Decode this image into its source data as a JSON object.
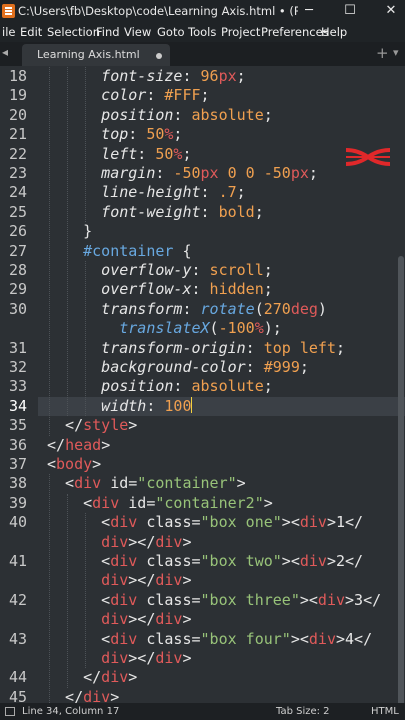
{
  "window": {
    "title": "C:\\Users\\fb\\Desktop\\code\\Learning Axis.html • (Project) - Su...",
    "minimize_glyph": "─",
    "maximize_glyph": "☐",
    "close_glyph": "✕"
  },
  "menu": [
    "ile",
    "Edit",
    "Selection",
    "Find",
    "View",
    "Goto",
    "Tools",
    "Project",
    "Preferences",
    "Help"
  ],
  "tab": {
    "label": "Learning Axis.html",
    "left_arrow": "◂",
    "new_tab": "+",
    "chevron": "▾"
  },
  "editor": {
    "current_line": "34",
    "lines": [
      {
        "n": "18",
        "indent": 3,
        "tokens": [
          [
            "p",
            "font-size"
          ],
          [
            "w",
            ": "
          ],
          [
            "n",
            "96"
          ],
          [
            "u",
            "px"
          ],
          [
            "w",
            ";"
          ]
        ]
      },
      {
        "n": "19",
        "indent": 3,
        "tokens": [
          [
            "p",
            "color"
          ],
          [
            "w",
            ": "
          ],
          [
            "n",
            "#FFF"
          ],
          [
            "w",
            ";"
          ]
        ]
      },
      {
        "n": "20",
        "indent": 3,
        "tokens": [
          [
            "p",
            "position"
          ],
          [
            "w",
            ": "
          ],
          [
            "v",
            "absolute"
          ],
          [
            "w",
            ";"
          ]
        ]
      },
      {
        "n": "21",
        "indent": 3,
        "tokens": [
          [
            "p",
            "top"
          ],
          [
            "w",
            ": "
          ],
          [
            "n",
            "50"
          ],
          [
            "u",
            "%"
          ],
          [
            "w",
            ";"
          ]
        ]
      },
      {
        "n": "22",
        "indent": 3,
        "tokens": [
          [
            "p",
            "left"
          ],
          [
            "w",
            ": "
          ],
          [
            "n",
            "50"
          ],
          [
            "u",
            "%"
          ],
          [
            "w",
            ";"
          ]
        ]
      },
      {
        "n": "23",
        "indent": 3,
        "tokens": [
          [
            "p",
            "margin"
          ],
          [
            "w",
            ": "
          ],
          [
            "n",
            "-50"
          ],
          [
            "u",
            "px"
          ],
          [
            "w",
            " "
          ],
          [
            "n",
            "0"
          ],
          [
            "w",
            " "
          ],
          [
            "n",
            "0"
          ],
          [
            "w",
            " "
          ],
          [
            "n",
            "-50"
          ],
          [
            "u",
            "px"
          ],
          [
            "w",
            ";"
          ]
        ]
      },
      {
        "n": "24",
        "indent": 3,
        "tokens": [
          [
            "p",
            "line-height"
          ],
          [
            "w",
            ": "
          ],
          [
            "n",
            ".7"
          ],
          [
            "w",
            ";"
          ]
        ]
      },
      {
        "n": "25",
        "indent": 3,
        "tokens": [
          [
            "p",
            "font-weight"
          ],
          [
            "w",
            ": "
          ],
          [
            "v",
            "bold"
          ],
          [
            "w",
            ";"
          ]
        ]
      },
      {
        "n": "26",
        "indent": 2,
        "tokens": [
          [
            "w",
            "}"
          ]
        ]
      },
      {
        "n": "27",
        "indent": 2,
        "tokens": [
          [
            "sel",
            "#container"
          ],
          [
            "w",
            " {"
          ]
        ]
      },
      {
        "n": "28",
        "indent": 3,
        "tokens": [
          [
            "p",
            "overflow-y"
          ],
          [
            "w",
            ": "
          ],
          [
            "v",
            "scroll"
          ],
          [
            "w",
            ";"
          ]
        ]
      },
      {
        "n": "29",
        "indent": 3,
        "tokens": [
          [
            "p",
            "overflow-x"
          ],
          [
            "w",
            ": "
          ],
          [
            "v",
            "hidden"
          ],
          [
            "w",
            ";"
          ]
        ]
      },
      {
        "n": "30",
        "indent": 3,
        "tokens": [
          [
            "p",
            "transform"
          ],
          [
            "w",
            ": "
          ],
          [
            "fn",
            "rotate"
          ],
          [
            "w",
            "("
          ],
          [
            "n",
            "270"
          ],
          [
            "u",
            "deg"
          ],
          [
            "w",
            ")"
          ]
        ]
      },
      {
        "n": "",
        "indent": 4,
        "tokens": [
          [
            "fn",
            "translateX"
          ],
          [
            "w",
            "("
          ],
          [
            "n",
            "-100"
          ],
          [
            "u",
            "%"
          ],
          [
            "w",
            ");"
          ]
        ]
      },
      {
        "n": "31",
        "indent": 3,
        "tokens": [
          [
            "p",
            "transform-origin"
          ],
          [
            "w",
            ": "
          ],
          [
            "v",
            "top left"
          ],
          [
            "w",
            ";"
          ]
        ]
      },
      {
        "n": "32",
        "indent": 3,
        "tokens": [
          [
            "p",
            "background-color"
          ],
          [
            "w",
            ": "
          ],
          [
            "n",
            "#999"
          ],
          [
            "w",
            ";"
          ]
        ]
      },
      {
        "n": "33",
        "indent": 3,
        "tokens": [
          [
            "p",
            "position"
          ],
          [
            "w",
            ": "
          ],
          [
            "v",
            "absolute"
          ],
          [
            "w",
            ";"
          ]
        ]
      },
      {
        "n": "34",
        "indent": 3,
        "caret": true,
        "tokens": [
          [
            "p",
            "width"
          ],
          [
            "w",
            ": "
          ],
          [
            "n",
            "100"
          ]
        ]
      },
      {
        "n": "35",
        "indent": 1,
        "tokens": [
          [
            "w",
            "</"
          ],
          [
            "tag",
            "style"
          ],
          [
            "w",
            ">"
          ]
        ]
      },
      {
        "n": "36",
        "indent": 0,
        "tokens": [
          [
            "w",
            "</"
          ],
          [
            "tag",
            "head"
          ],
          [
            "w",
            ">"
          ]
        ]
      },
      {
        "n": "37",
        "indent": 0,
        "tokens": [
          [
            "w",
            "<"
          ],
          [
            "tag",
            "body"
          ],
          [
            "w",
            ">"
          ]
        ]
      },
      {
        "n": "38",
        "indent": 1,
        "tokens": [
          [
            "w",
            "<"
          ],
          [
            "tag",
            "div"
          ],
          [
            "w",
            " "
          ],
          [
            "at",
            "id"
          ],
          [
            "w",
            "="
          ],
          [
            "str",
            "\"container\""
          ],
          [
            "w",
            ">"
          ]
        ]
      },
      {
        "n": "39",
        "indent": 2,
        "tokens": [
          [
            "w",
            "<"
          ],
          [
            "tag",
            "div"
          ],
          [
            "w",
            " "
          ],
          [
            "at",
            "id"
          ],
          [
            "w",
            "="
          ],
          [
            "str",
            "\"container2\""
          ],
          [
            "w",
            ">"
          ]
        ]
      },
      {
        "n": "40",
        "indent": 3,
        "tokens": [
          [
            "w",
            "<"
          ],
          [
            "tag",
            "div"
          ],
          [
            "w",
            " "
          ],
          [
            "at",
            "class"
          ],
          [
            "w",
            "="
          ],
          [
            "str",
            "\"box one\""
          ],
          [
            "w",
            "><"
          ],
          [
            "tag",
            "div"
          ],
          [
            "w",
            ">1</"
          ]
        ]
      },
      {
        "n": "",
        "indent": 3,
        "tokens": [
          [
            "tag",
            "div"
          ],
          [
            "w",
            "></"
          ],
          [
            "tag",
            "div"
          ],
          [
            "w",
            ">"
          ]
        ]
      },
      {
        "n": "41",
        "indent": 3,
        "tokens": [
          [
            "w",
            "<"
          ],
          [
            "tag",
            "div"
          ],
          [
            "w",
            " "
          ],
          [
            "at",
            "class"
          ],
          [
            "w",
            "="
          ],
          [
            "str",
            "\"box two\""
          ],
          [
            "w",
            "><"
          ],
          [
            "tag",
            "div"
          ],
          [
            "w",
            ">2</"
          ]
        ]
      },
      {
        "n": "",
        "indent": 3,
        "tokens": [
          [
            "tag",
            "div"
          ],
          [
            "w",
            "></"
          ],
          [
            "tag",
            "div"
          ],
          [
            "w",
            ">"
          ]
        ]
      },
      {
        "n": "42",
        "indent": 3,
        "tokens": [
          [
            "w",
            "<"
          ],
          [
            "tag",
            "div"
          ],
          [
            "w",
            " "
          ],
          [
            "at",
            "class"
          ],
          [
            "w",
            "="
          ],
          [
            "str",
            "\"box three\""
          ],
          [
            "w",
            "><"
          ],
          [
            "tag",
            "div"
          ],
          [
            "w",
            ">3</"
          ]
        ]
      },
      {
        "n": "",
        "indent": 3,
        "tokens": [
          [
            "tag",
            "div"
          ],
          [
            "w",
            "></"
          ],
          [
            "tag",
            "div"
          ],
          [
            "w",
            ">"
          ]
        ]
      },
      {
        "n": "43",
        "indent": 3,
        "tokens": [
          [
            "w",
            "<"
          ],
          [
            "tag",
            "div"
          ],
          [
            "w",
            " "
          ],
          [
            "at",
            "class"
          ],
          [
            "w",
            "="
          ],
          [
            "str",
            "\"box four\""
          ],
          [
            "w",
            "><"
          ],
          [
            "tag",
            "div"
          ],
          [
            "w",
            ">4</"
          ]
        ]
      },
      {
        "n": "",
        "indent": 3,
        "tokens": [
          [
            "tag",
            "div"
          ],
          [
            "w",
            "></"
          ],
          [
            "tag",
            "div"
          ],
          [
            "w",
            ">"
          ]
        ]
      },
      {
        "n": "44",
        "indent": 2,
        "tokens": [
          [
            "w",
            "</"
          ],
          [
            "tag",
            "div"
          ],
          [
            "w",
            ">"
          ]
        ]
      },
      {
        "n": "45",
        "indent": 1,
        "tokens": [
          [
            "w",
            "</"
          ],
          [
            "tag",
            "div"
          ],
          [
            "w",
            ">"
          ]
        ]
      }
    ]
  },
  "status": {
    "position": "Line 34, Column 17",
    "tab_size": "Tab Size: 2",
    "syntax": "HTML"
  },
  "colors": {
    "background": "#2c3034",
    "current_line": "#3b4046",
    "property": "#e6e6e6",
    "number": "#f0a050",
    "unit": "#e05a5a",
    "selector": "#68a8e0",
    "string": "#98c379",
    "logo": "#e0282a"
  }
}
